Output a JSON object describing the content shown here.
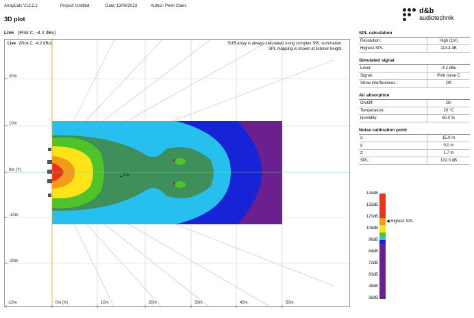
{
  "header": {
    "app": "ArrayCalc V12.2.1",
    "project": "Project: Untitled",
    "date": "Date: 13/06/2023",
    "author": "Author: Peter Claes"
  },
  "logo": {
    "line1": "d&b",
    "line2": "audiotechnik"
  },
  "page_title": "3D plot",
  "live": {
    "label": "Live",
    "signal": "(Pink C, -4.2 dBu)",
    "inner_label": "Live",
    "inner_signal": "(Pink C, -4.2 dBu)"
  },
  "plot": {
    "note1": "SUB array is always calculated using complex SPL summation.",
    "note2": "SPL mapping is shown at listener height.",
    "y_ticks": [
      "20m",
      "10m",
      "0m (Y)",
      "-10m",
      "-20m"
    ],
    "x_ticks": [
      "-10m",
      "0m (X)",
      "10m",
      "20m",
      "30m",
      "40m",
      "50m"
    ],
    "cal_label": "Cal"
  },
  "spl_calculation": {
    "title": "SPL calculation",
    "rows": [
      {
        "k": "Resolution:",
        "v": "High (1m)"
      },
      {
        "k": "Highest SPL:",
        "v": "113.4 dB"
      }
    ]
  },
  "simulated_signal": {
    "title": "Simulated signal",
    "rows": [
      {
        "k": "Level:",
        "v": "-4.2 dBu"
      },
      {
        "k": "Signal:",
        "v": "Pink noise C"
      },
      {
        "k": "Show interferences:",
        "v": "Off"
      }
    ]
  },
  "air_absorption": {
    "title": "Air absorption",
    "rows": [
      {
        "k": "On/Off:",
        "v": "On"
      },
      {
        "k": "Temperature:",
        "v": "20 °C"
      },
      {
        "k": "Humidity:",
        "v": "60.0 %"
      }
    ]
  },
  "noise_calibration": {
    "title": "Noise calibration point",
    "rows": [
      {
        "k": "x:",
        "v": "15.0 m"
      },
      {
        "k": "y:",
        "v": "0.0 m"
      },
      {
        "k": "z:",
        "v": "1.7 m"
      },
      {
        "k": "SPL:",
        "v": "102.0 dB"
      }
    ]
  },
  "legend": {
    "ticks": [
      "144dB",
      "132dB",
      "120dB",
      "108dB",
      "96dB",
      "84dB",
      "72dB",
      "60dB",
      "48dB",
      "36dB"
    ],
    "highest_label": "Highest SPL"
  },
  "colors": {
    "red": "#e8331a",
    "orange": "#f39a1d",
    "yellow": "#fde318",
    "green": "#4ec32a",
    "darkgreen": "#3f8f5a",
    "lightblue": "#27c0ee",
    "blue": "#1623d6",
    "purple": "#6c1f8e"
  }
}
